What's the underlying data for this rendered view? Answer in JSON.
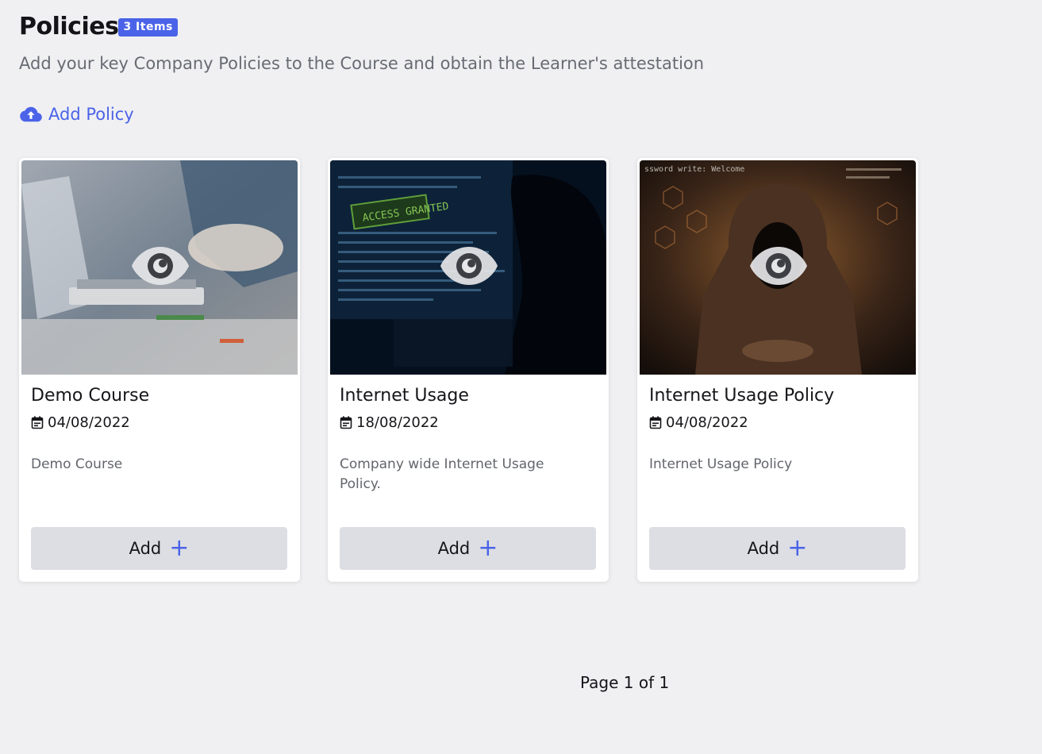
{
  "header": {
    "title": "Policies",
    "badge": "3 Items",
    "subtitle": "Add your key Company Policies to the Course and obtain the Learner's attestation"
  },
  "toolbar": {
    "add_policy_label": "Add Policy",
    "add_policy_icon": "cloud-upload-icon"
  },
  "cards": [
    {
      "title": "Demo Course",
      "date": "04/08/2022",
      "description": "Demo Course",
      "button_label": "Add",
      "button_icon": "plus-icon",
      "preview_icon": "eye-icon",
      "thumbnail_alt": "Office desk with laptop"
    },
    {
      "title": "Internet Usage",
      "date": "18/08/2022",
      "description": "Company wide Internet Usage Policy.",
      "button_label": "Add",
      "button_icon": "plus-icon",
      "preview_icon": "eye-icon",
      "thumbnail_alt": "Person at computer screen in the dark"
    },
    {
      "title": "Internet Usage Policy",
      "date": "04/08/2022",
      "description": "Internet Usage Policy",
      "button_label": "Add",
      "button_icon": "plus-icon",
      "preview_icon": "eye-icon",
      "thumbnail_alt": "Hooded hacker figure"
    }
  ],
  "pagination": {
    "label": "Page 1 of 1"
  },
  "colors": {
    "accent": "#4a63e8",
    "background": "#f0f0f2",
    "button_bg": "#dcdee3"
  }
}
